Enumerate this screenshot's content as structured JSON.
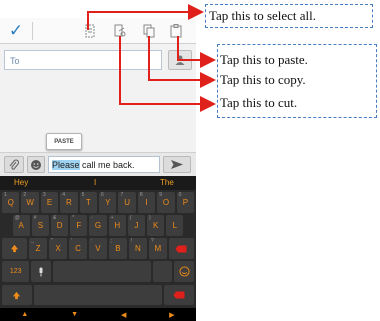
{
  "toolbar": {
    "done_icon": "check-icon",
    "select_all_icon": "select-all-icon",
    "cut_icon": "cut-icon",
    "copy_icon": "copy-icon",
    "paste_icon": "paste-icon"
  },
  "recipient": {
    "placeholder": "To"
  },
  "context_popup": {
    "label": "PASTE"
  },
  "message": {
    "selected": "Please",
    "rest": " call me back."
  },
  "keyboard": {
    "suggestions": [
      "Hey",
      "I",
      "The"
    ],
    "row1": [
      [
        "Q",
        "1"
      ],
      [
        "W",
        "2"
      ],
      [
        "E",
        "3"
      ],
      [
        "R",
        "4"
      ],
      [
        "T",
        "5"
      ],
      [
        "Y",
        "6"
      ],
      [
        "U",
        "7"
      ],
      [
        "I",
        "8"
      ],
      [
        "O",
        "9"
      ],
      [
        "P",
        "0"
      ]
    ],
    "row2": [
      [
        "A",
        "@"
      ],
      [
        "S",
        "#"
      ],
      [
        "D",
        "&"
      ],
      [
        "F",
        "*"
      ],
      [
        "G",
        "-"
      ],
      [
        "H",
        "+"
      ],
      [
        "J",
        "("
      ],
      [
        "K",
        ")"
      ],
      [
        "L",
        ""
      ]
    ],
    "row3": [
      [
        "Z",
        "_"
      ],
      [
        "X",
        "\""
      ],
      [
        "C",
        "'"
      ],
      [
        "V",
        ":"
      ],
      [
        "B",
        ";"
      ],
      [
        "N",
        "!"
      ],
      [
        "M",
        "?"
      ]
    ],
    "num_key": "123"
  },
  "callouts": {
    "select_all": "Tap this to select all.",
    "paste": "Tap this to paste.",
    "copy": "Tap this to copy.",
    "cut": "Tap this to cut."
  },
  "colors": {
    "accent": "#f08c1a",
    "arrow": "#e0201a",
    "callout_border": "#4a7cc2",
    "selection": "#9fd3f2"
  }
}
